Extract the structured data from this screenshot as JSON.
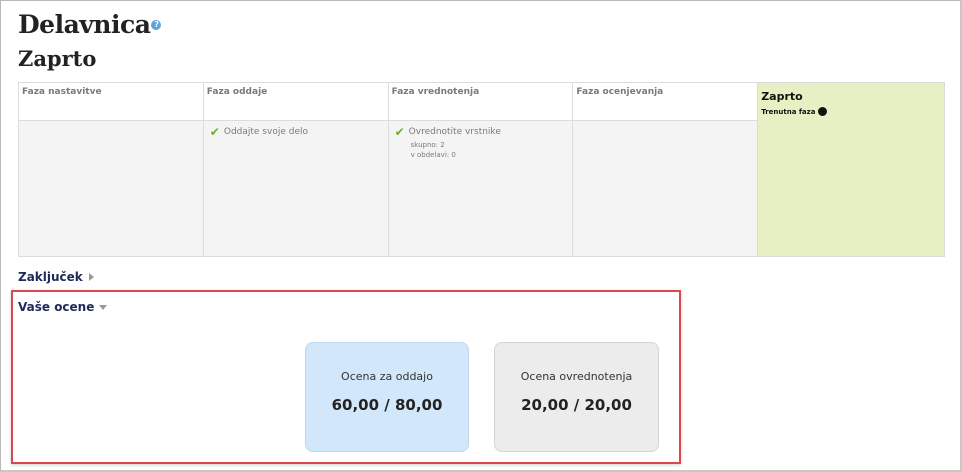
{
  "page": {
    "title": "Delavnica",
    "subtitle": "Zaprto",
    "help_icon": "?"
  },
  "phases": [
    {
      "name": "Faza nastavitve",
      "tasks": []
    },
    {
      "name": "Faza oddaje",
      "tasks": [
        {
          "label": "Oddajte svoje delo",
          "icon": "check-icon"
        }
      ]
    },
    {
      "name": "Faza vrednotenja",
      "tasks": [
        {
          "label": "Ovrednotite vrstnike",
          "icon": "check-icon",
          "details": [
            "skupno: 2",
            "v obdelavi: 0"
          ]
        }
      ]
    },
    {
      "name": "Faza ocenjevanja",
      "tasks": []
    },
    {
      "name": "Zaprto",
      "current_label": "Trenutna faza",
      "active": true
    }
  ],
  "sections": {
    "conclusion": {
      "label": "Zaključek",
      "state": "collapsed"
    },
    "grades": {
      "label": "Vaše ocene",
      "state": "expanded"
    }
  },
  "grades": {
    "submission": {
      "label": "Ocena za oddajo",
      "value": "60,00 / 80,00"
    },
    "assessment": {
      "label": "Ocena ovrednotenja",
      "value": "20,00 / 20,00"
    }
  },
  "colors": {
    "active_phase": "#e6f0c2",
    "check": "#6ab12c",
    "submission_card": "#d2e8fa",
    "assessment_card": "#ececec",
    "highlight": "#d9484d"
  }
}
